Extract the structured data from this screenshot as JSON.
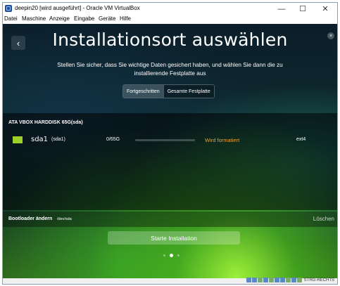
{
  "window": {
    "title": "deepin20 [wird ausgeführt] - Oracle VM VirtualBox",
    "minimize_glyph": "—",
    "maximize_glyph": "☐",
    "close_glyph": "✕"
  },
  "menu": [
    "Datei",
    "Maschine",
    "Anzeige",
    "Eingabe",
    "Geräte",
    "Hilfe"
  ],
  "installer": {
    "back_glyph": "‹",
    "close_glyph": "×",
    "title": "Installationsort auswählen",
    "subtitle": "Stellen Sie sicher, dass Sie wichtige Daten gesichert haben, und wählen Sie dann die zu installierende Festplatte aus",
    "tabs": [
      {
        "label": "Fortgeschritten",
        "active": true
      },
      {
        "label": "Gesamte Festplatte",
        "active": false
      }
    ],
    "disk": {
      "label": "ATA VBOX HARDDISK 65G(sda)",
      "partition": {
        "name": "sda1",
        "device": "(sda1)",
        "size": "0/65G",
        "status": "Wird formatiert",
        "filesystem": "ext4",
        "usage_fraction": 0
      }
    },
    "bootloader": {
      "label": "Bootloader ändern",
      "path": "/dev/sda",
      "delete_label": "Löschen"
    },
    "install_button": "Starte Installation",
    "page_dots": {
      "count": 3,
      "current": 1
    }
  },
  "statusbar": {
    "host_key": "STRG-RECHTS"
  },
  "colors": {
    "accent_green": "#9bd12a",
    "status_orange": "#e8a23a"
  }
}
